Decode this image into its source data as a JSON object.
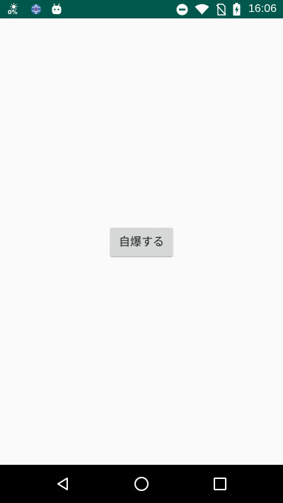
{
  "status_bar": {
    "background": "#00574b",
    "time": "16:06",
    "cpu_usage": "0%",
    "left_icons": [
      "cpu-usage-icon",
      "app-globe-icon",
      "android-robot-icon"
    ],
    "right_icons": [
      "do-not-disturb-icon",
      "wifi-icon",
      "no-sim-icon",
      "battery-charging-icon"
    ]
  },
  "main": {
    "background": "#fafafa",
    "button_label": "自爆する",
    "button_color": "#d6d7d7"
  },
  "nav_bar": {
    "background": "#000000",
    "buttons": [
      "back-icon",
      "home-icon",
      "recents-icon"
    ]
  }
}
